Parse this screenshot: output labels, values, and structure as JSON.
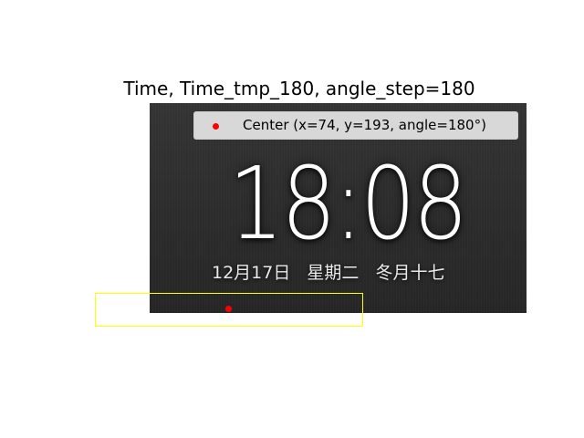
{
  "figure": {
    "title": "Time, Time_tmp_180, angle_step=180"
  },
  "screen": {
    "time": "18:08",
    "date_parts": [
      "12月17日",
      "星期二",
      "冬月十七"
    ]
  },
  "legend": {
    "label": "Center (x=74, y=193, angle=180°)",
    "marker_color": "#ff0000"
  },
  "overlay": {
    "box_color": "#ffff00",
    "point_color": "#ff0000"
  }
}
